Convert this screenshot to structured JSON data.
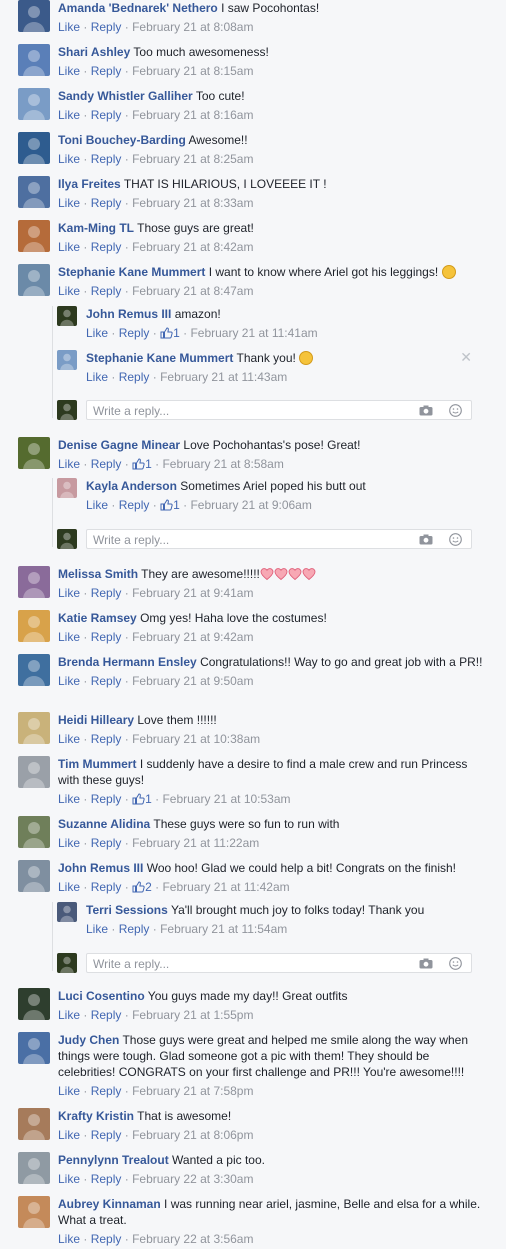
{
  "ui": {
    "like_label": "Like",
    "reply_label": "Reply",
    "separator": "·",
    "write_reply_placeholder": "Write a reply..."
  },
  "comments": [
    {
      "author": "Amanda 'Bednarek' Nethero",
      "text": "I saw Pocohontas!",
      "time": "February 21 at 8:08am"
    },
    {
      "author": "Shari Ashley",
      "text": "Too much awesomeness!",
      "time": "February 21 at 8:15am"
    },
    {
      "author": "Sandy Whistler Galliher",
      "text": "Too cute!",
      "time": "February 21 at 8:16am"
    },
    {
      "author": "Toni Bouchey-Barding",
      "text": "Awesome!!",
      "time": "February 21 at 8:25am"
    },
    {
      "author": "Ilya Freites",
      "text": "THAT IS HILARIOUS, I LOVEEEE IT !",
      "time": "February 21 at 8:33am"
    },
    {
      "author": "Kam-Ming TL",
      "text": "Those guys are great!",
      "time": "February 21 at 8:42am"
    },
    {
      "author": "Stephanie Kane Mummert",
      "text": "I want to know where Ariel got his leggings!",
      "time": "February 21 at 8:47am",
      "replies": [
        {
          "author": "John Remus III",
          "text": "amazon!",
          "likes": "1",
          "time": "February 21 at 11:41am"
        },
        {
          "author": "Stephanie Kane Mummert",
          "text": "Thank you!",
          "time": "February 21 at 11:43am"
        }
      ]
    },
    {
      "author": "Denise Gagne Minear",
      "text": "Love Pochohantas's pose! Great!",
      "likes": "1",
      "time": "February 21 at 8:58am",
      "replies": [
        {
          "author": "Kayla Anderson",
          "text": "Sometimes Ariel poped his butt out",
          "likes": "1",
          "time": "February 21 at 9:06am"
        }
      ]
    },
    {
      "author": "Melissa Smith",
      "text": "They are awesome!!!!!",
      "time": "February 21 at 9:41am"
    },
    {
      "author": "Katie Ramsey",
      "text": "Omg yes! Haha love the costumes!",
      "time": "February 21 at 9:42am"
    },
    {
      "author": "Brenda Hermann Ensley",
      "text": "Congratulations!! Way to go and great job with a PR!!",
      "time": "February 21 at 9:50am"
    },
    {
      "author": "Heidi Hilleary",
      "text": "Love them !!!!!!",
      "time": "February 21 at 10:38am"
    },
    {
      "author": "Tim Mummert",
      "text": "I suddenly have a desire to find a male crew and run Princess with these guys!",
      "likes": "1",
      "time": "February 21 at 10:53am"
    },
    {
      "author": "Suzanne Alidina",
      "text": "These guys were so fun to run with",
      "time": "February 21 at 11:22am"
    },
    {
      "author": "John Remus III",
      "text": "Woo hoo! Glad we could help a bit! Congrats on the finish!",
      "likes": "2",
      "time": "February 21 at 11:42am",
      "replies": [
        {
          "author": "Terri Sessions",
          "text": "Ya'll brought much joy to folks today! Thank you",
          "time": "February 21 at 11:54am"
        }
      ]
    },
    {
      "author": "Luci Cosentino",
      "text": "You guys made my day!! Great outfits",
      "time": "February 21 at 1:55pm"
    },
    {
      "author": "Judy Chen",
      "text": "Those guys were great and helped me smile along the way when things were tough. Glad someone got a pic with them! They should be celebrities! CONGRATS on your first challenge and PR!!! You're awesome!!!!",
      "time": "February 21 at 7:58pm"
    },
    {
      "author": "Krafty Kristin",
      "text": "That is awesome!",
      "time": "February 21 at 8:06pm"
    },
    {
      "author": "Pennylynn Trealout",
      "text": "Wanted a pic too.",
      "time": "February 22 at 3:30am"
    },
    {
      "author": "Aubrey Kinnaman",
      "text": "I was running near ariel, jasmine, Belle and elsa for a while. What a treat.",
      "time": "February 22 at 3:56am"
    }
  ]
}
